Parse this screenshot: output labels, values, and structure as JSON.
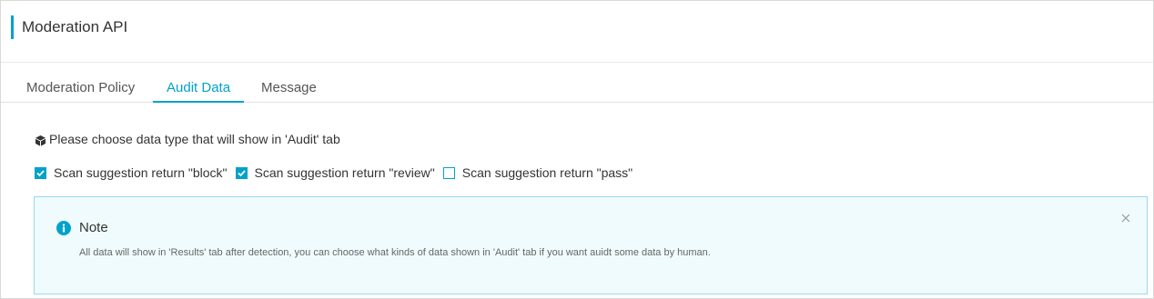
{
  "header": {
    "title": "Moderation API"
  },
  "tabs": [
    {
      "label": "Moderation Policy",
      "active": false
    },
    {
      "label": "Audit Data",
      "active": true
    },
    {
      "label": "Message",
      "active": false
    }
  ],
  "audit": {
    "section_label": "Please choose data type that will show in 'Audit' tab",
    "section_icon": "cube-icon",
    "options": [
      {
        "label": "Scan suggestion return \"block\"",
        "checked": true
      },
      {
        "label": "Scan suggestion return \"review\"",
        "checked": true
      },
      {
        "label": "Scan suggestion return \"pass\"",
        "checked": false
      }
    ]
  },
  "note": {
    "title": "Note",
    "text": "All data will show in 'Results' tab after detection, you can choose what kinds of data shown in 'Audit' tab if you want auidt some data by human.",
    "icon": "info-icon",
    "close_icon": "close-icon"
  },
  "colors": {
    "accent": "#00a2ca",
    "note_bg": "#f0fbfd",
    "note_border": "#9ad9e7"
  }
}
